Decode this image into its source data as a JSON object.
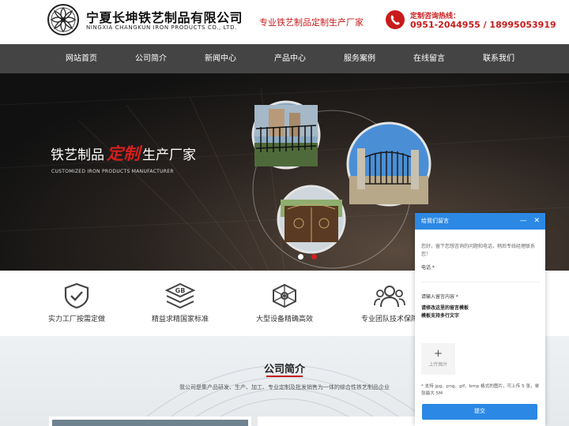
{
  "header": {
    "company_cn": "宁夏长坤铁艺制品有限公司",
    "company_en": "NINGXIA CHANGKUN IRON PRODUCTS CO., LTD.",
    "slogan": "专业铁艺制品定制生产厂家",
    "hotline_label": "定制咨询热线：",
    "hotline_numbers": "0951-2044955 / 18995053919"
  },
  "nav": {
    "items": [
      "网站首页",
      "公司简介",
      "新闻中心",
      "产品中心",
      "服务案例",
      "在线留言",
      "联系我们"
    ]
  },
  "banner": {
    "title_prefix": "铁艺制品",
    "title_accent": "定制",
    "title_suffix": "生产厂家",
    "subtitle": "CUSTOMIZED IRON PRODUCTS MANUFACTURER",
    "active_dot": 2
  },
  "features": [
    {
      "label": "实力工厂按需定做",
      "icon": "shield-check-icon"
    },
    {
      "label": "精益求精国家标准",
      "icon": "gb-standard-icon"
    },
    {
      "label": "大型设备精确高效",
      "icon": "equipment-icon"
    },
    {
      "label": "专业团队技术保障",
      "icon": "team-icon"
    }
  ],
  "about": {
    "title": "公司简介",
    "desc": "我公司是集产品研发、生产、加工、专业定制及批发销售为一体的综合性铁艺制品企业"
  },
  "message_panel": {
    "title": "给我们留言",
    "tip": "您好，留下您想咨询的问题和电话，稍后专线经理联系您！",
    "phone_label": "电话 *",
    "phone_value": "",
    "content_label": "请输入留言内容 *",
    "content_value": "请修改这里的留言模板\n模板支持多行文字",
    "upload_label": "上传图片",
    "upload_plus": "+",
    "note": "* 支持 jpg、png、gif、bmp 格式的图片，可上传 5 张，单张最大 5M",
    "submit": "提交",
    "minimize": "—",
    "close": "✕"
  },
  "colors": {
    "brand_red": "#c91b1b",
    "nav_bg": "#444444",
    "panel_blue": "#2b88e5"
  }
}
